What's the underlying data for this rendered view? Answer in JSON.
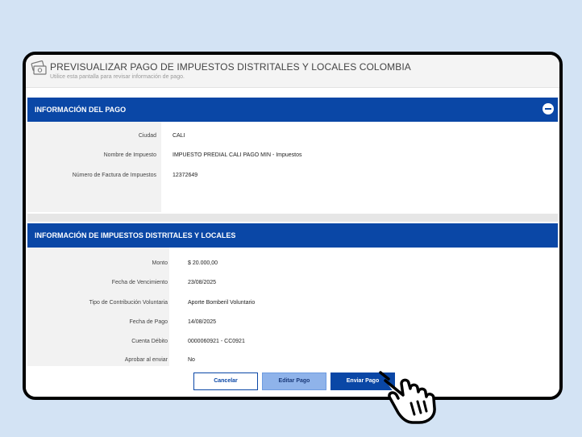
{
  "header": {
    "title": "PREVISUALIZAR PAGO DE IMPUESTOS DISTRITALES Y LOCALES COLOMBIA",
    "subtitle": "Utilice esta pantalla para revisar información de pago."
  },
  "payment_info": {
    "title": "INFORMACIÓN DEL PAGO",
    "fields": [
      {
        "label": "Ciudad",
        "value": "CALI"
      },
      {
        "label": "Nombre de Impuesto",
        "value": "IMPUESTO PREDIAL CALI PAGO MIN - Impuestos"
      },
      {
        "label": "Número de Factura de Impuestos",
        "value": "12372649"
      }
    ]
  },
  "tax_info": {
    "title": "INFORMACIÓN DE IMPUESTOS DISTRITALES Y LOCALES",
    "fields": [
      {
        "label": "Monto",
        "value": "$ 20.000,00"
      },
      {
        "label": "Fecha de Vencimiento",
        "value": "23/08/2025"
      },
      {
        "label": "Tipo de Contribución Voluntaria",
        "value": "Aporte Bomberil Voluntario"
      },
      {
        "label": "Fecha de Pago",
        "value": "14/08/2025"
      },
      {
        "label": "Cuenta Débito",
        "value": "0000060921 - CC0921"
      },
      {
        "label": "Aprobar al enviar",
        "value": "No"
      }
    ]
  },
  "buttons": {
    "cancel": "Cancelar",
    "edit": "Editar Pago",
    "send": "Enviar Pago"
  },
  "icons": {
    "header": "payment-cards-icon",
    "collapse": "minus-circle-icon",
    "pointer": "hand-pointer-icon"
  },
  "colors": {
    "accent": "#0a47a6",
    "background": "#d3e3f4"
  }
}
